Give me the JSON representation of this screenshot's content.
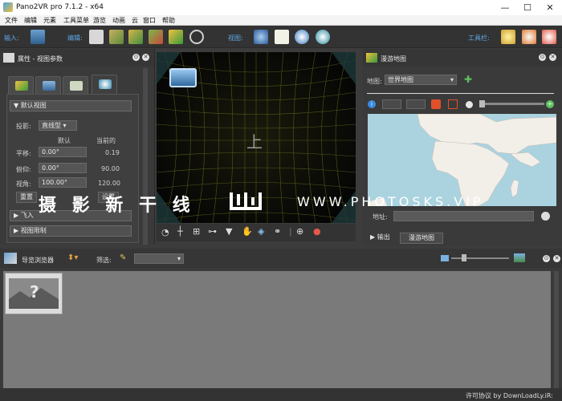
{
  "window": {
    "title": "Pano2VR pro 7.1.2 - x64",
    "min": "—",
    "max": "☐",
    "close": "✕"
  },
  "menu": [
    "文件",
    "编辑",
    "元素",
    "工具菜单",
    "游览",
    "动画",
    "云",
    "窗口",
    "帮助"
  ],
  "toolbar": {
    "input_label": "输入:",
    "edit_label": "编辑:",
    "view_label": "视图:",
    "toolbar_label": "工具栏:"
  },
  "properties": {
    "title": "属性 - 视图参数",
    "section_default_view": "默认视图",
    "projection_label": "投影:",
    "projection_value": "直线型",
    "col_default": "默认",
    "col_current": "当前的",
    "pan_label": "平移:",
    "pan_value": "0.00°",
    "pan_current": "0.19",
    "tilt_label": "俯仰:",
    "tilt_value": "0.00°",
    "tilt_current": "90.00",
    "fov_label": "视角:",
    "fov_value": "100.00°",
    "fov_current": "120.00",
    "reset_label": "重置",
    "set_label": "设置",
    "section_fly_in": "飞入",
    "section_view_limits": "视图限制"
  },
  "viewer": {
    "zenith_glyph": "上"
  },
  "tour_map": {
    "title": "漫游地图",
    "map_label": "地图:",
    "map_value": "世界地图",
    "address_label": "地址:",
    "tab_output": "输出",
    "tab_tour_map": "漫游地图"
  },
  "tour_browser": {
    "title": "导览浏览器",
    "filter_label": "筛选:"
  },
  "watermark": {
    "text": "摄 影 新 干 线",
    "url": "WWW.PHOTOSKS.VIP"
  },
  "status": {
    "license": "许可协议 by DownLoadLy.iR:"
  },
  "colors": {
    "accent_blue": "#5fa8e8",
    "panel_bg": "#3a3a3a",
    "grid_yellow": "#6e7a1e"
  }
}
